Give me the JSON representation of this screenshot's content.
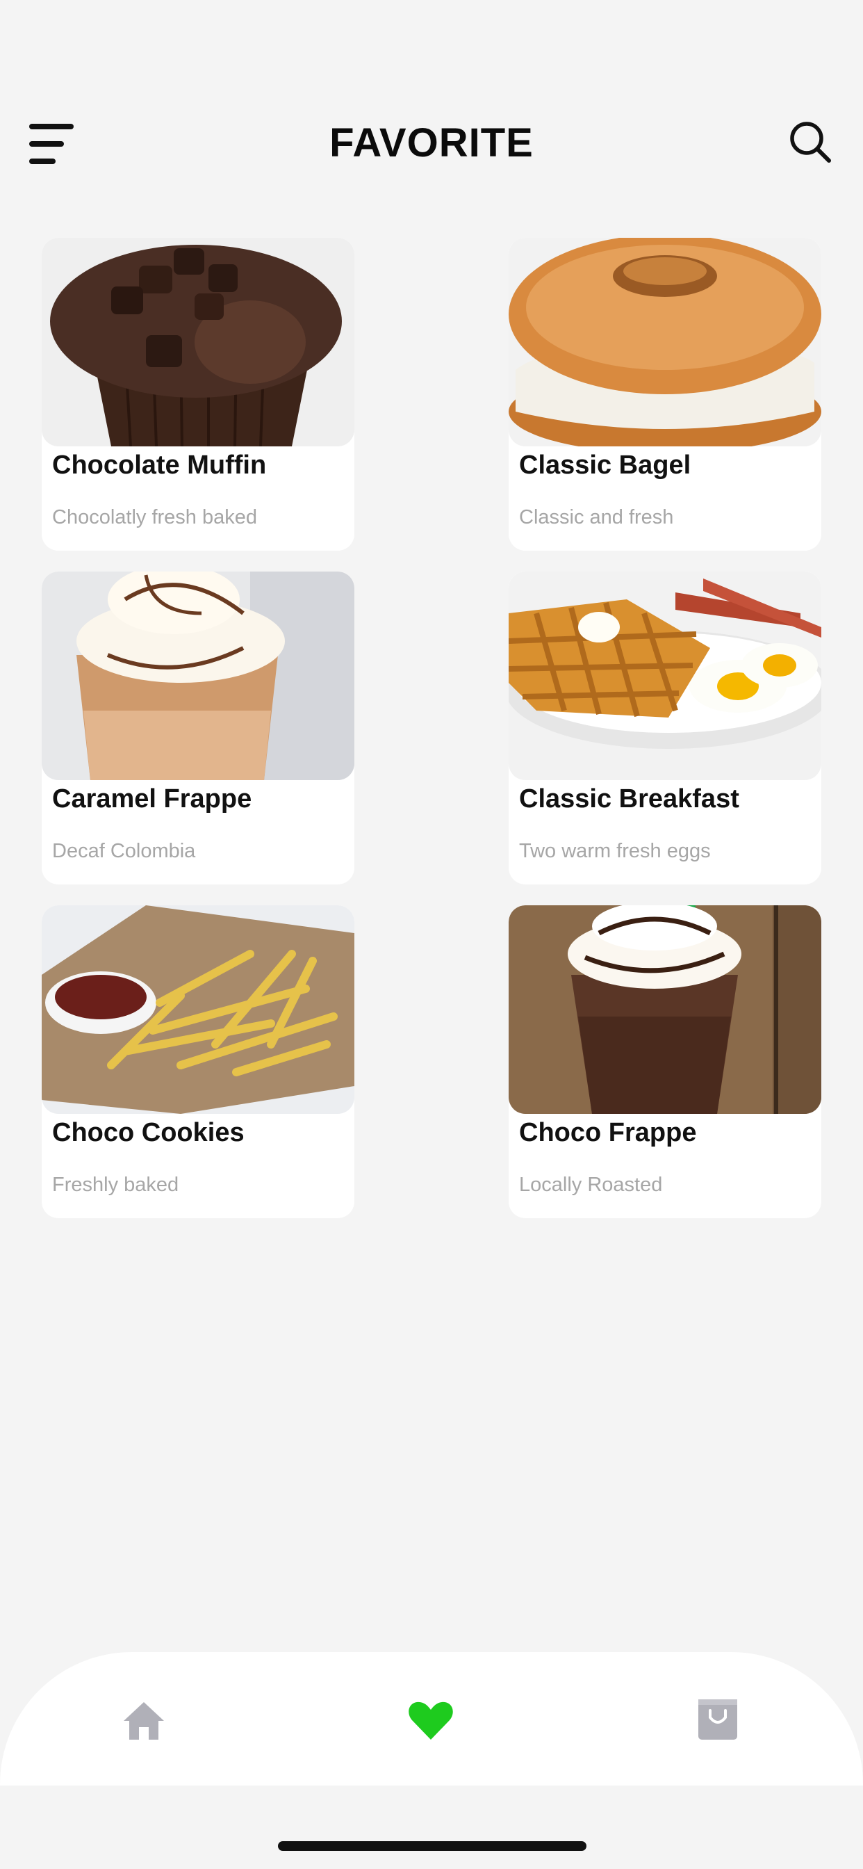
{
  "header": {
    "title": "FAVORITE",
    "menu_icon": "hamburger-menu-icon",
    "search_icon": "search-icon"
  },
  "favorites": [
    {
      "name": "Chocolate Muffin",
      "description": "Chocolatly fresh baked"
    },
    {
      "name": "Classic Bagel",
      "description": "Classic and fresh"
    },
    {
      "name": "Caramel Frappe",
      "description": "Decaf Colombia"
    },
    {
      "name": "Classic Breakfast",
      "description": "Two warm fresh eggs"
    },
    {
      "name": "Choco Cookies",
      "description": "Freshly baked"
    },
    {
      "name": "Choco Frappe",
      "description": "Locally Roasted"
    }
  ],
  "bottom_nav": {
    "items": [
      {
        "icon": "home-icon",
        "active": false
      },
      {
        "icon": "heart-icon",
        "active": true
      },
      {
        "icon": "shopping-bag-icon",
        "active": false
      }
    ],
    "active_color": "#1ecb1e",
    "inactive_color": "#b0b0b8"
  }
}
